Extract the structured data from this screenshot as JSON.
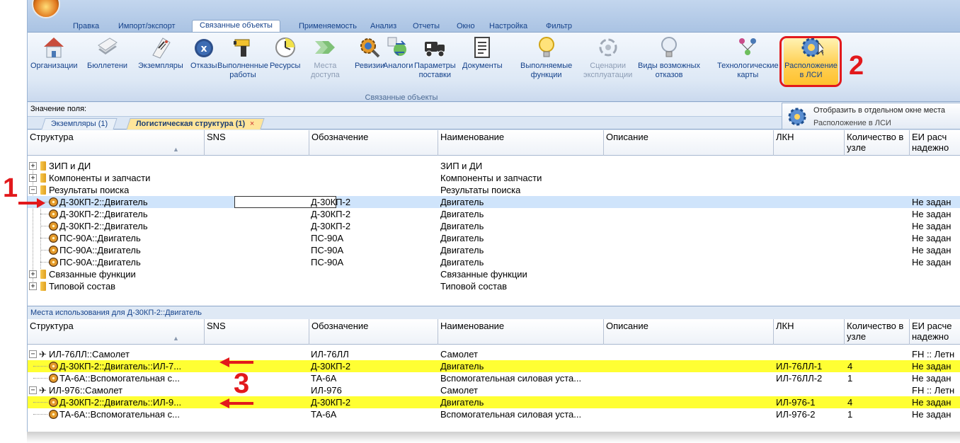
{
  "menu": {
    "tabs": [
      "Правка",
      "Импорт/экспорт",
      "Связанные объекты",
      "Применяемость",
      "Анализ",
      "Отчеты",
      "Окно",
      "Настройка",
      "Фильтр"
    ],
    "active_tab": "Связанные объекты"
  },
  "ribbon": {
    "buttons": {
      "orgs": "Организации",
      "bulletins": "Бюллетени",
      "instances": "Экземпляры",
      "failures": "Отказы",
      "works_1": "Выполненные",
      "works_2": "работы",
      "resources": "Ресурсы",
      "access_1": "Места",
      "access_2": "доступа",
      "revisions": "Ревизии",
      "analogs": "Аналоги",
      "supply_1": "Параметры",
      "supply_2": "поставки",
      "documents": "Документы",
      "functions_1": "Выполняемые",
      "functions_2": "функции",
      "scenarios_1": "Сценарии",
      "scenarios_2": "эксплуатации",
      "failtypes_1": "Виды возможных",
      "failtypes_2": "отказов",
      "techcards_1": "Технологические",
      "techcards_2": "карты",
      "location_1": "Расположение",
      "location_2": "в ЛСИ"
    },
    "group_label": "Связанные объекты"
  },
  "annotations": {
    "n1": "1",
    "n2": "2",
    "n3": "3"
  },
  "field_label": "Значение поля:",
  "doc_tabs": {
    "tab1": "Экземпляры (1)",
    "tab2": "Логистическая структура (1)",
    "close": "×"
  },
  "tooltip": {
    "title": "Отобразить в отдельном окне места",
    "subtitle": "Расположение в ЛСИ"
  },
  "top_grid": {
    "headers": {
      "structure": "Структура",
      "sns": "SNS",
      "designation": "Обозначение",
      "name": "Наименование",
      "description": "Описание",
      "lkn": "ЛКН",
      "qty_1": "Количество в",
      "qty_2": "узле",
      "ei_1": "ЕИ расч",
      "ei_2": "надежно"
    },
    "rows": [
      {
        "structure": "ЗИП и ДИ",
        "designation": "",
        "name": "ЗИП и ДИ",
        "ei": ""
      },
      {
        "structure": "Компоненты и запчасти",
        "designation": "",
        "name": "Компоненты и запчасти",
        "ei": ""
      },
      {
        "structure": "Результаты поиска",
        "designation": "",
        "name": "Результаты поиска",
        "ei": ""
      },
      {
        "structure": "Д-30КП-2::Двигатель",
        "designation": "Д-30КП-2",
        "name": "Двигатель",
        "ei": "Не задан"
      },
      {
        "structure": "Д-30КП-2::Двигатель",
        "designation": "Д-30КП-2",
        "name": "Двигатель",
        "ei": "Не задан"
      },
      {
        "structure": "Д-30КП-2::Двигатель",
        "designation": "Д-30КП-2",
        "name": "Двигатель",
        "ei": "Не задан"
      },
      {
        "structure": "ПС-90А::Двигатель",
        "designation": "ПС-90А",
        "name": "Двигатель",
        "ei": "Не задан"
      },
      {
        "structure": "ПС-90А::Двигатель",
        "designation": "ПС-90А",
        "name": "Двигатель",
        "ei": "Не задан"
      },
      {
        "structure": "ПС-90А::Двигатель",
        "designation": "ПС-90А",
        "name": "Двигатель",
        "ei": "Не задан"
      },
      {
        "structure": "Связанные функции",
        "designation": "",
        "name": "Связанные функции",
        "ei": ""
      },
      {
        "structure": "Типовой состав",
        "designation": "",
        "name": "Типовой состав",
        "ei": ""
      }
    ]
  },
  "usage_title": "Места использования для Д-30КП-2::Двигатель",
  "bottom_grid": {
    "headers": {
      "structure": "Структура",
      "sns": "SNS",
      "designation": "Обозначение",
      "name": "Наименование",
      "description": "Описание",
      "lkn": "ЛКН",
      "qty_1": "Количество в",
      "qty_2": "узле",
      "ei_1": "ЕИ расче",
      "ei_2": "надежно"
    },
    "rows": [
      {
        "structure": "ИЛ-76ЛЛ::Самолет",
        "designation": "ИЛ-76ЛЛ",
        "name": "Самолет",
        "lkn": "",
        "qty": "",
        "ei": "FH :: Летн"
      },
      {
        "structure": "Д-30КП-2::Двигатель::ИЛ-7...",
        "designation": "Д-30КП-2",
        "name": "Двигатель",
        "lkn": "ИЛ-76ЛЛ-1",
        "qty": "4",
        "ei": "Не задан"
      },
      {
        "structure": "ТА-6А::Вспомогательная с...",
        "designation": "ТА-6А",
        "name": "Вспомогательная силовая уста...",
        "lkn": "ИЛ-76ЛЛ-2",
        "qty": "1",
        "ei": "Не задан"
      },
      {
        "structure": "ИЛ-976::Самолет",
        "designation": "ИЛ-976",
        "name": "Самолет",
        "lkn": "",
        "qty": "",
        "ei": "FH :: Летн"
      },
      {
        "structure": "Д-30КП-2::Двигатель::ИЛ-9...",
        "designation": "Д-30КП-2",
        "name": "Двигатель",
        "lkn": "ИЛ-976-1",
        "qty": "4",
        "ei": "Не задан"
      },
      {
        "structure": "ТА-6А::Вспомогательная с...",
        "designation": "ТА-6А",
        "name": "Вспомогательная силовая уста...",
        "lkn": "ИЛ-976-2",
        "qty": "1",
        "ei": "Не задан"
      }
    ]
  },
  "colors": {
    "highlight": "#ffff33",
    "selection": "#cfe4fb",
    "annotation": "#e2191c",
    "ribbon_text": "#15428b"
  }
}
